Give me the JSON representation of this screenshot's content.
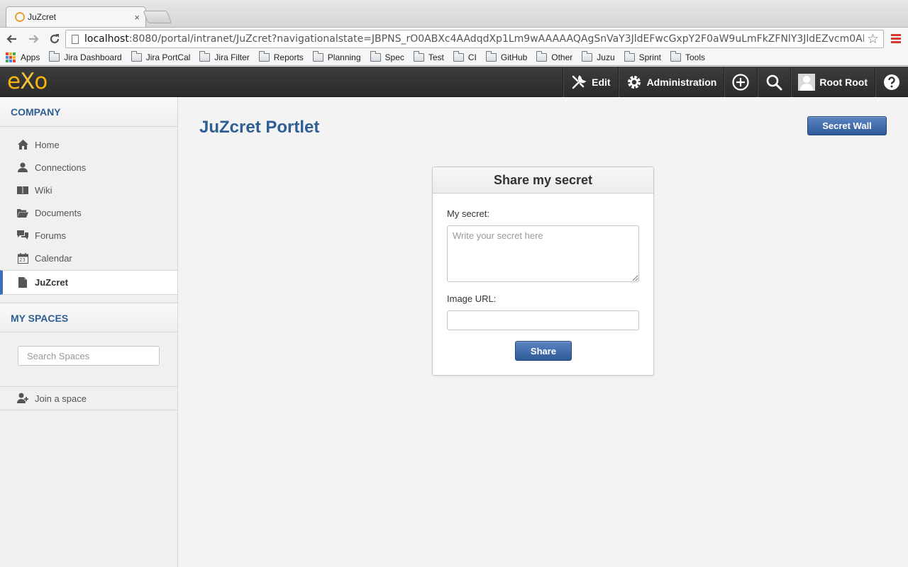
{
  "browser": {
    "tab_title": "JuZcret",
    "tab_close": "×",
    "url_host": "localhost",
    "url_rest": ":8080/portal/intranet/JuZcret?navigationalstate=JBPNS_rO0ABXc4AAdqdXp1Lm9wAAAAAQAgSnVaY3JldEFwcGxpY2F0aW9uLmFkZFNlY3JldEZvcm0AB1…",
    "star": "☆",
    "bookmarks": [
      "Apps",
      "Jira Dashboard",
      "Jira PortCal",
      "Jira Filter",
      "Reports",
      "Planning",
      "Spec",
      "Test",
      "CI",
      "GitHub",
      "Other",
      "Juzu",
      "Sprint",
      "Tools"
    ]
  },
  "topbar": {
    "logo_e": "e",
    "logo_x": "X",
    "logo_o": "o",
    "edit_label": "Edit",
    "admin_label": "Administration",
    "user_name": "Root Root"
  },
  "sidebar": {
    "company_heading": "COMPANY",
    "items": [
      {
        "label": "Home",
        "icon": "home-icon"
      },
      {
        "label": "Connections",
        "icon": "user-icon"
      },
      {
        "label": "Wiki",
        "icon": "book-icon"
      },
      {
        "label": "Documents",
        "icon": "folder-open-icon"
      },
      {
        "label": "Forums",
        "icon": "chat-icon"
      },
      {
        "label": "Calendar",
        "icon": "calendar-icon"
      },
      {
        "label": "JuZcret",
        "icon": "page-icon"
      }
    ],
    "calendar_day": "23",
    "spaces_heading": "MY SPACES",
    "search_placeholder": "Search Spaces",
    "join_label": "Join a space"
  },
  "main": {
    "page_title": "JuZcret Portlet",
    "wall_button": "Secret Wall",
    "form": {
      "title": "Share my secret",
      "secret_label": "My secret:",
      "secret_placeholder": "Write your secret here",
      "image_label": "Image URL:",
      "image_value": "",
      "share_button": "Share"
    }
  },
  "colors": {
    "accent": "#2f5e92",
    "button": "#3a67a8",
    "logo": "#f5b30f",
    "topbar": "#333333"
  }
}
